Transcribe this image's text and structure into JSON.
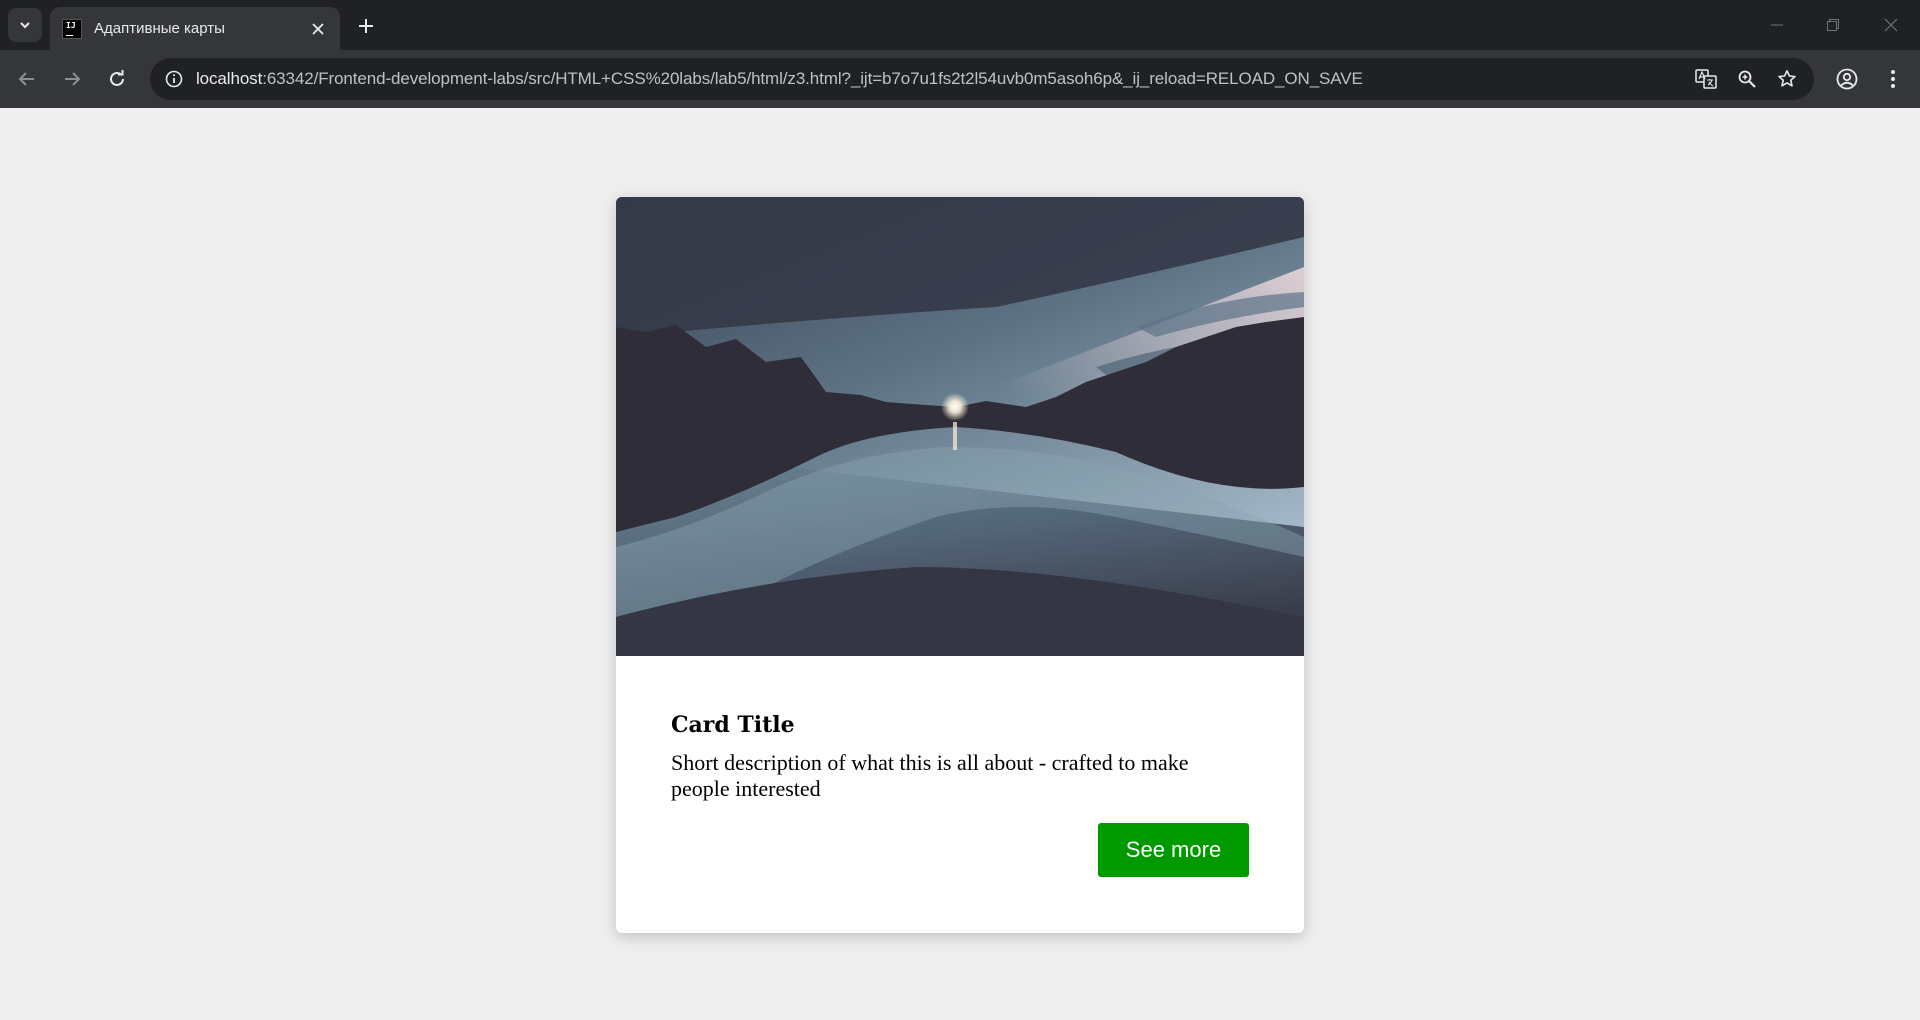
{
  "browser": {
    "tab": {
      "title": "Адаптивные карты",
      "favicon_text": "IJ"
    },
    "address_bar": {
      "host": "localhost",
      "path": ":63342/Frontend-development-labs/src/HTML+CSS%20labs/lab5/html/z3.html?_ijt=b7o7u1fs2t2l54uvb0m5asoh6p&_ij_reload=RELOAD_ON_SAVE"
    },
    "icons": {
      "tab_search": "chevron-down-icon",
      "close_tab": "close-icon",
      "new_tab": "plus-icon",
      "back": "arrow-left-icon",
      "forward": "arrow-right-icon",
      "reload": "reload-icon",
      "site_info": "info-icon",
      "translate": "translate-icon",
      "zoom": "zoom-icon",
      "bookmark": "star-icon",
      "profile": "profile-icon",
      "menu": "kebab-icon",
      "minimize": "minimize-icon",
      "restore": "restore-icon",
      "close_window": "close-icon"
    }
  },
  "card": {
    "title": "Card Title",
    "description": "Short description of what this is all about - crafted to make people interested",
    "button_label": "See more",
    "button_color": "#009900"
  },
  "colors": {
    "page_background": "#eeeeee",
    "card_background": "#ffffff",
    "chrome_dark": "#202124",
    "chrome_toolbar": "#35363a"
  }
}
